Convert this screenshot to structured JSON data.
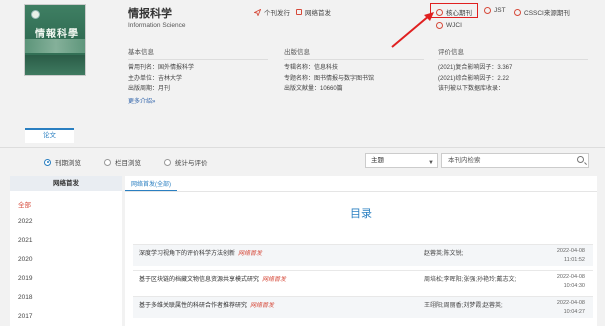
{
  "journal": {
    "title": "情报科学",
    "subtitle": "Information Science",
    "cover_text": "情報科學"
  },
  "header_links": {
    "online_issue": "个刊发行",
    "online_first": "网络首发",
    "core": "核心期刊",
    "jst": "JST",
    "cssci": "CSSCI来源期刊",
    "wjci": "WJCI"
  },
  "sections": {
    "basic": {
      "head": "基本信息",
      "lines": [
        "曾用刊名：国外情报科学",
        "主办单位：吉林大学",
        "出版周期：月刊"
      ]
    },
    "publish": {
      "head": "出版信息",
      "lines": [
        "专辑名称：信息科技",
        "专题名称：图书情报与数字图书馆",
        "出版文献量：10660篇"
      ]
    },
    "eval": {
      "head": "评价信息",
      "lines": [
        "(2021)复合影响因子：3.367",
        "(2021)综合影响因子：2.22",
        "该刊被以下数据库收录："
      ]
    },
    "more": "更多介绍»"
  },
  "tabs": {
    "papers": "论文"
  },
  "browse": {
    "by_issue": "刊期浏览",
    "by_column": "栏目浏览",
    "by_stats": "统计与评价"
  },
  "filter": {
    "select_value": "主题",
    "search_placeholder": "本刊内检索"
  },
  "left": {
    "header": "网络首发",
    "items": [
      "全部",
      "2022",
      "2021",
      "2020",
      "2019",
      "2018",
      "2017"
    ]
  },
  "right": {
    "tab": "网络首发(全部)",
    "toc_title": "目录",
    "rows": [
      {
        "title": "深度学习视角下的评价科学方法创新",
        "tag": "网络首发",
        "authors": "赵蓉英;陈文锐;",
        "date": "2022-04-08",
        "time": "11:01:52"
      },
      {
        "title": "基于区块链的档藏文物信息资源共享模式研究",
        "tag": "网络首发",
        "authors": "周培松;李晖阳;张强;孙艳玲;戴志文;",
        "date": "2022-04-08",
        "time": "10:04:30"
      },
      {
        "title": "基于多维关联属性的科研合作者推荐研究",
        "tag": "网络首发",
        "authors": "王翊阳;周丽香;刘梦霞;赵蓉英;",
        "date": "2022-04-08",
        "time": "10:04:27"
      }
    ]
  },
  "colors": {
    "accent": "#2a7fc1",
    "highlight": "#e02020",
    "brand_red": "#d64a3a"
  }
}
